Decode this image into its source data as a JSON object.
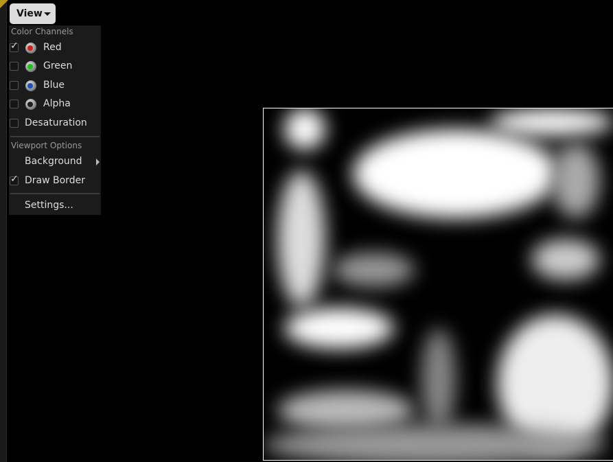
{
  "toolbar": {
    "view_label": "View"
  },
  "menu": {
    "color_channels_header": "Color Channels",
    "channels": [
      {
        "label": "Red",
        "checked": true,
        "color": "#d02020"
      },
      {
        "label": "Green",
        "checked": false,
        "color": "#20c020"
      },
      {
        "label": "Blue",
        "checked": false,
        "color": "#2050c0"
      },
      {
        "label": "Alpha",
        "checked": false,
        "color": "#202020"
      }
    ],
    "desaturation": {
      "label": "Desaturation",
      "checked": false
    },
    "viewport_options_header": "Viewport Options",
    "background_label": "Background",
    "draw_border": {
      "label": "Draw Border",
      "checked": true
    },
    "settings_label": "Settings..."
  }
}
